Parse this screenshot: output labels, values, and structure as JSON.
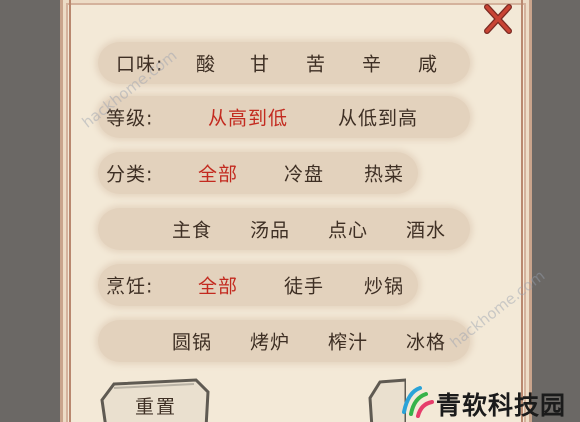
{
  "rows": {
    "taste": {
      "label": "口味:",
      "options": [
        "酸",
        "甘",
        "苦",
        "辛",
        "咸"
      ]
    },
    "grade": {
      "label": "等级:",
      "options": [
        "从高到低",
        "从低到高"
      ]
    },
    "category": {
      "label": "分类:",
      "options": [
        "全部",
        "冷盘",
        "热菜"
      ],
      "options2": [
        "主食",
        "汤品",
        "点心",
        "酒水"
      ]
    },
    "cooking": {
      "label": "烹饪:",
      "options": [
        "全部",
        "徒手",
        "炒锅"
      ],
      "options2": [
        "圆锅",
        "烤炉",
        "榨汁",
        "冰格"
      ]
    }
  },
  "buttons": {
    "reset": "重置"
  },
  "watermark": {
    "text": "hackhome.com",
    "logo_text": "青软科技园"
  },
  "colors": {
    "selected": "#c32a1f",
    "text": "#3e2f24",
    "close_icon": "#b8362b"
  },
  "selected": {
    "grade": 0,
    "category": 0,
    "cooking": 0
  }
}
